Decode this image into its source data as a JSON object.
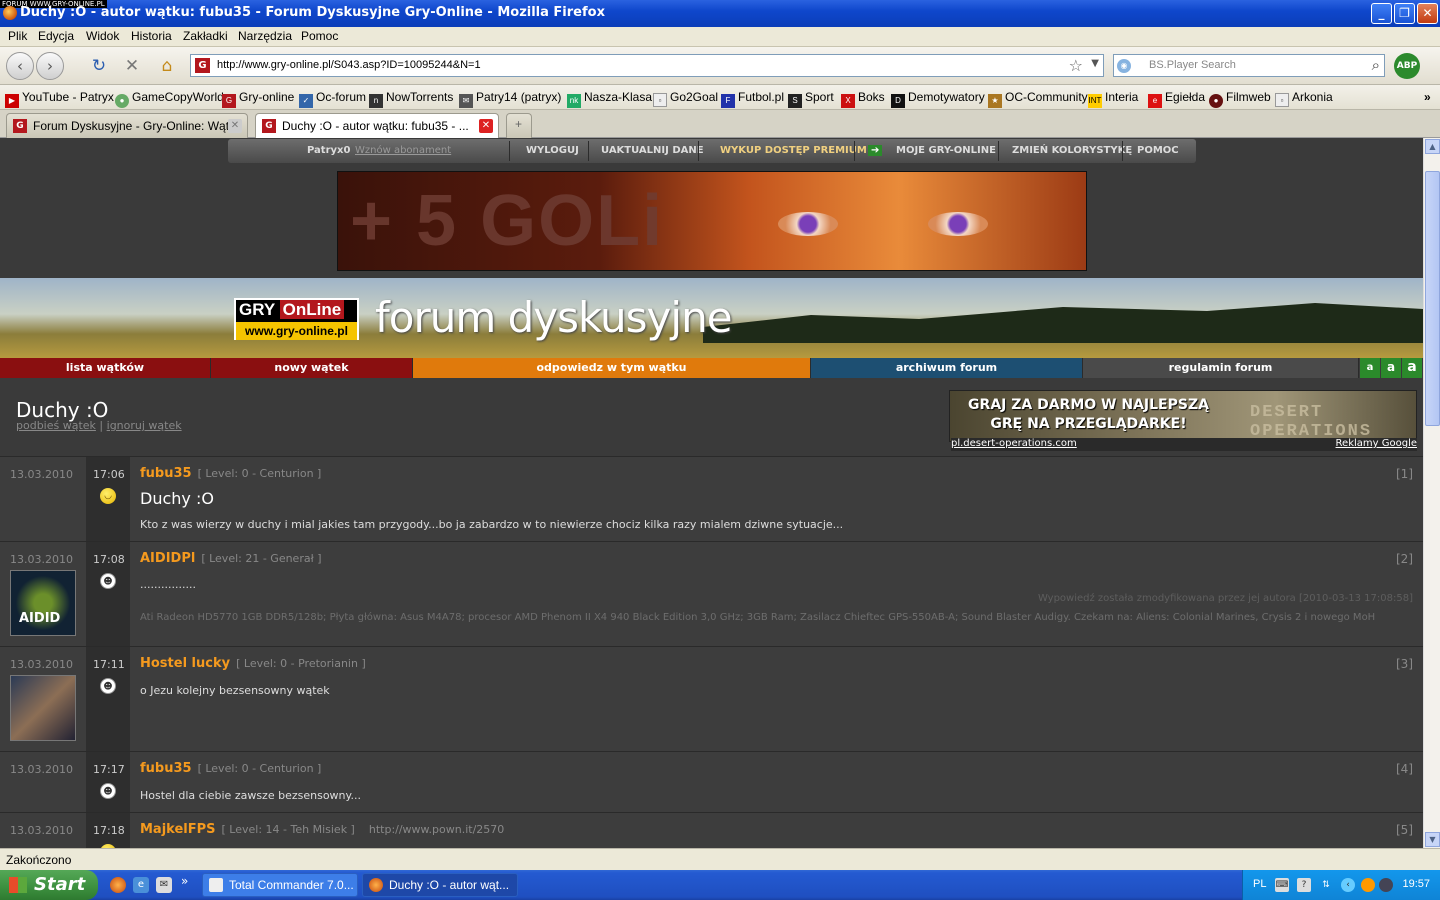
{
  "window": {
    "title": "Duchy :O - autor wątku: fubu35 - Forum Dyskusyjne Gry-Online - Mozilla Firefox",
    "watermark": "FORUM WWW.GRY-ONLINE.PL",
    "controls": {
      "minimize": "_",
      "maximize": "❐",
      "close": "✕"
    }
  },
  "menu": [
    "Plik",
    "Edycja",
    "Widok",
    "Historia",
    "Zakładki",
    "Narzędzia",
    "Pomoc"
  ],
  "toolbar": {
    "back": "‹",
    "forward": "›",
    "reload": "↻",
    "stop": "✕",
    "home": "⌂",
    "url": "http://www.gry-online.pl/S043.asp?ID=10095244&N=1",
    "search_placeholder": "BS.Player Search",
    "abp": "ABP"
  },
  "bookmarks": [
    "YouTube - Patryx",
    "GameCopyWorld",
    "Gry-online",
    "Oc-forum",
    "NowTorrents",
    "Patry14 (patryx)",
    "Nasza-Klasa",
    "Go2Goal",
    "Futbol.pl",
    "Sport",
    "Boks",
    "Demotywatory",
    "OC-Community",
    "Interia",
    "Egiełda",
    "Filmweb",
    "Arkonia"
  ],
  "bookmarks_overflow": "»",
  "tabs": [
    {
      "label": "Forum Dyskusyjne - Gry-Online: Wątki",
      "active": false
    },
    {
      "label": "Duchy :O - autor wątku: fubu35 - ...",
      "active": true
    }
  ],
  "tab_new": "+",
  "site_topbar": {
    "user": "Patryx0",
    "renew": "Wznów abonament",
    "items": [
      "WYLOGUJ",
      "UAKTUALNIJ DANE",
      "WYKUP DOSTĘP PREMIUM",
      "MOJE GRY-ONLINE",
      "ZMIEŃ KOLORYSTYKĘ",
      "POMOC"
    ]
  },
  "banner_text": "+ 5 GOLi",
  "logo": {
    "top": "GRY",
    "top2": "OnLine",
    "bottom": "www.gry-online.pl"
  },
  "forum_title": "forum dyskusyjne",
  "forum_nav": [
    {
      "label": "lista wątków",
      "color": "#8a0f10"
    },
    {
      "label": "nowy wątek",
      "color": "#8a0f10"
    },
    {
      "label": "odpowiedz w tym wątku",
      "color": "#e07a0c"
    },
    {
      "label": "archiwum forum",
      "color": "#1d4f72"
    },
    {
      "label": "regulamin forum",
      "color": "#4a4a4a"
    }
  ],
  "font_sizes": [
    "a",
    "a",
    "a"
  ],
  "thread": {
    "title": "Duchy :O",
    "link_bump": "podbieś wątek",
    "link_ignore": "ignoruj wątek",
    "separator": "|"
  },
  "ad": {
    "text": "GRAJ ZA DARMO W NAJLEPSZĄ GRĘ NA PRZEGLĄDARKE!",
    "brand": "DESERT OPERATIONS",
    "url": "pl.desert-operations.com",
    "google": "Reklamy Google"
  },
  "posts": [
    {
      "date": "13.03.2010",
      "time": "17:06",
      "author": "fubu35",
      "level": "[ Level: 0 - Centurion ]",
      "num": "[1]",
      "subject": "Duchy :O",
      "body": "Kto z was wierzy w duchy i mial jakies tam przygody...bo ja zabardzo w to niewierze chociz kilka razy mialem dziwne sytuacje..."
    },
    {
      "date": "13.03.2010",
      "time": "17:08",
      "author": "AIDIDPl",
      "level": "[ Level: 21 - Generał ]",
      "num": "[2]",
      "body": "................",
      "modified": "Wypowiedź została zmodyfikowana przez jej autora [2010-03-13 17:08:58]",
      "signature": "Ati Radeon HD5770 1GB DDR5/128b; Płyta główna: Asus M4A78; procesor AMD Phenom II X4 940 Black Edition 3,0 GHz; 3GB Ram; Zasilacz Chieftec GPS-550AB-A; Sound Blaster Audigy. Czekam na: Aliens: Colonial Marines, Crysis 2 i nowego MoH",
      "avatar_text": "AIDID"
    },
    {
      "date": "13.03.2010",
      "time": "17:11",
      "author": "Hostel lucky",
      "level": "[ Level: 0 - Pretorianin ]",
      "num": "[3]",
      "body": "o Jezu kolejny bezsensowny wątek"
    },
    {
      "date": "13.03.2010",
      "time": "17:17",
      "author": "fubu35",
      "level": "[ Level: 0 - Centurion ]",
      "num": "[4]",
      "body": "Hostel dla ciebie zawsze bezsensowny..."
    },
    {
      "date": "13.03.2010",
      "time": "17:18",
      "author": "MajkelFPS",
      "level": "[ Level: 14 - Teh Misiek ]",
      "num": "[5]",
      "link": "http://www.pown.it/2570"
    }
  ],
  "status_text": "Zakończono",
  "taskbar": {
    "start": "Start",
    "tasks": [
      {
        "label": "Total Commander 7.0...",
        "active": false
      },
      {
        "label": "Duchy :O - autor wąt...",
        "active": true
      }
    ],
    "more": "»",
    "lang": "PL",
    "clock": "19:57"
  }
}
